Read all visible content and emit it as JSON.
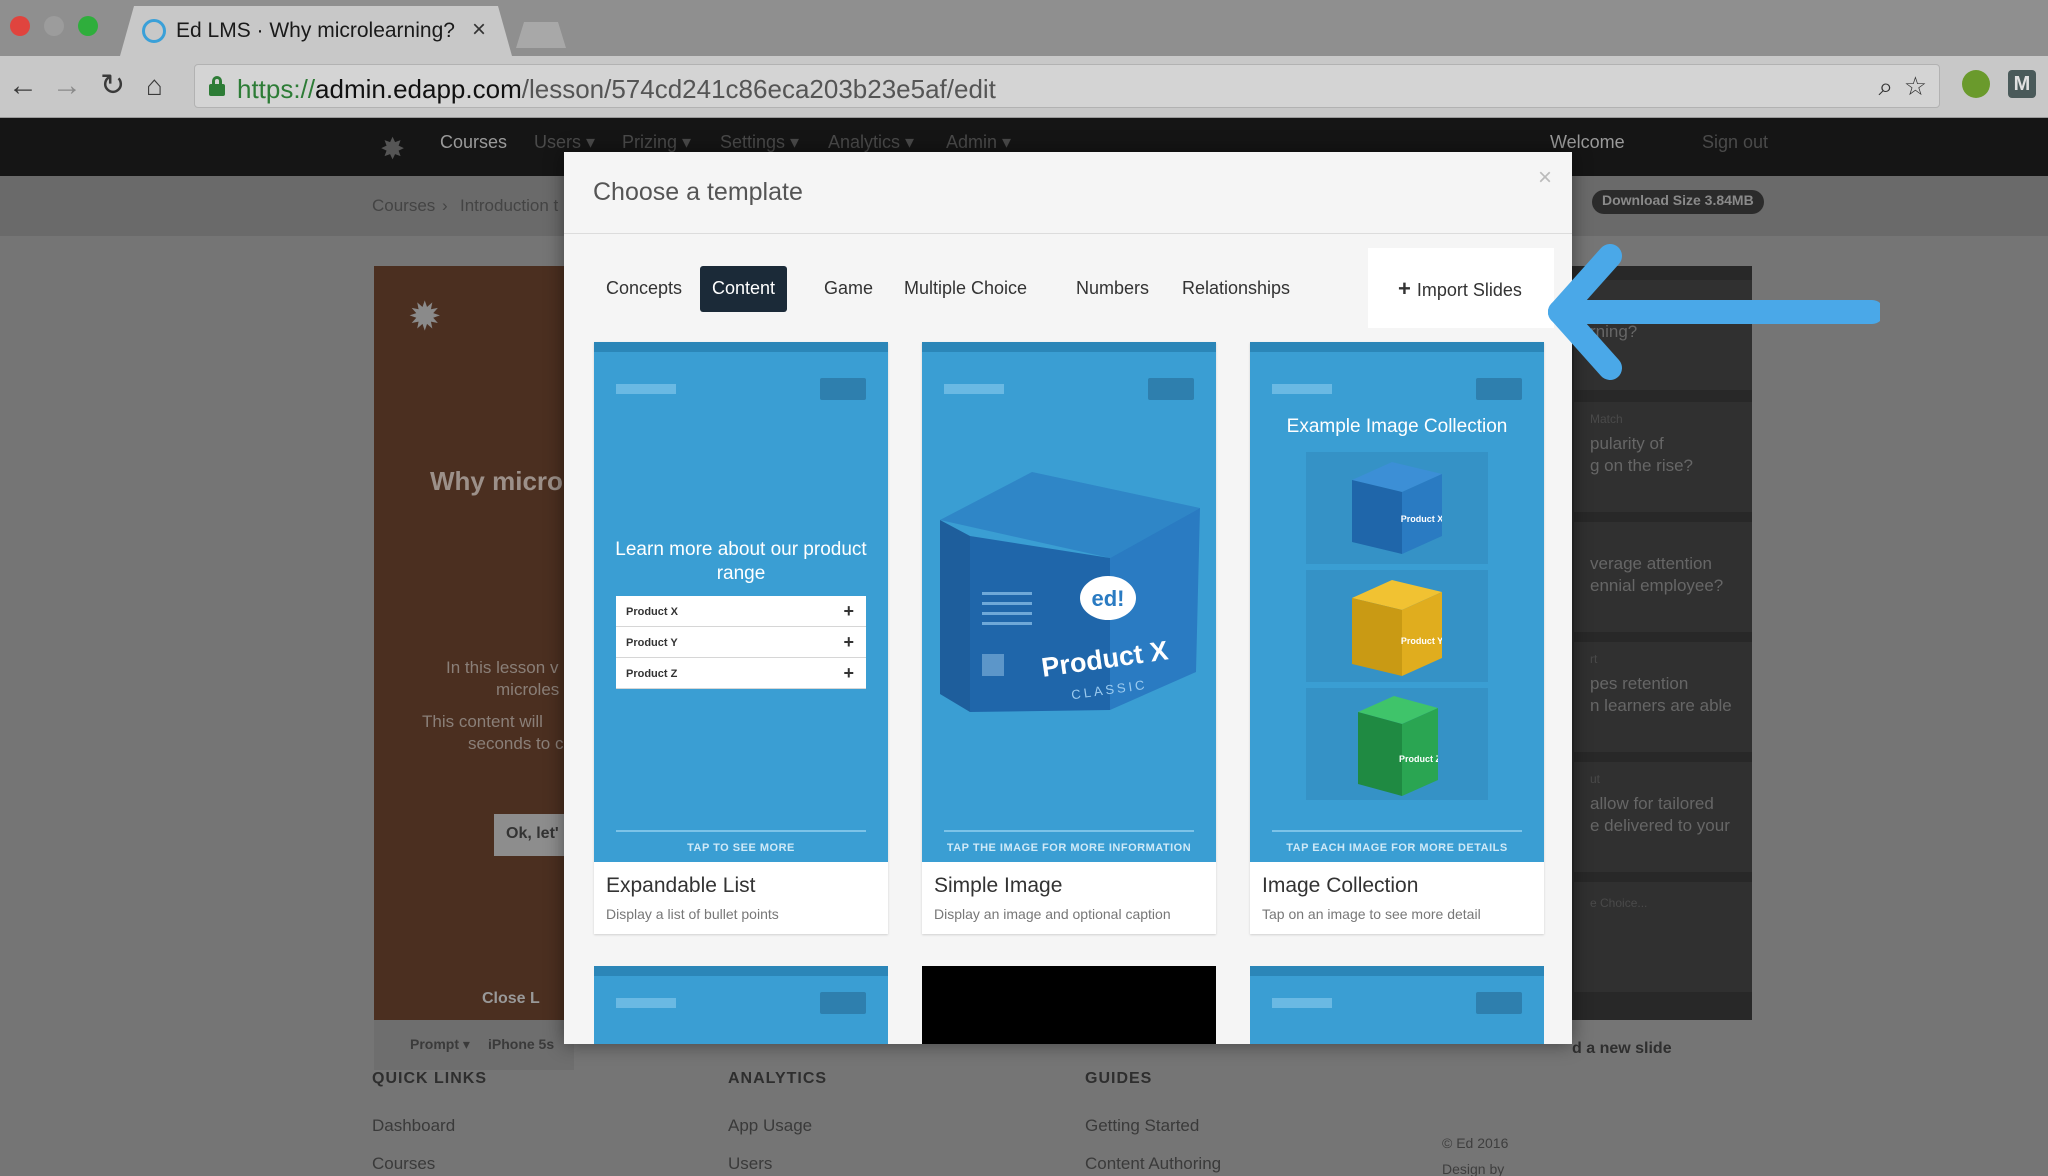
{
  "browser": {
    "tab_title": "Ed LMS · Why microlearning?",
    "url_scheme": "https://",
    "url_host": "admin.edapp.com",
    "url_path": "/lesson/574cd241c86eca203b23e5af/edit"
  },
  "app_nav": {
    "items": [
      "Courses",
      "Users ▾",
      "Prizing ▾",
      "Settings ▾",
      "Analytics ▾",
      "Admin ▾"
    ],
    "welcome": "Welcome",
    "sign_out": "Sign out"
  },
  "breadcrumb": {
    "root": "Courses",
    "sep": "›",
    "current": "Introduction t"
  },
  "download_badge": "Download Size 3.84MB",
  "preview": {
    "title": "Why micro",
    "line1": "In this lesson v",
    "line2": "microles",
    "line3": "This content will",
    "line4": "seconds to c",
    "button": "Ok, let'",
    "close": "Close L",
    "footer_prompt": "Prompt ▾",
    "footer_device": "iPhone 5s"
  },
  "slide_list": {
    "items": [
      {
        "tag": "",
        "text1": "rning?",
        "text2": ""
      },
      {
        "tag": "Match",
        "text1": "pularity of",
        "text2": "g on the rise?"
      },
      {
        "tag": "",
        "text1": "verage attention",
        "text2": "ennial employee?"
      },
      {
        "tag": "rt",
        "text1": "pes retention",
        "text2": "n learners are able"
      },
      {
        "tag": "ut",
        "text1": "allow for tailored",
        "text2": "e delivered to your"
      },
      {
        "tag": "e Choice...",
        "text1": "",
        "text2": ""
      }
    ],
    "add_new": "d a new slide"
  },
  "footer": {
    "quick_links": {
      "heading": "QUICK LINKS",
      "links": [
        "Dashboard",
        "Courses"
      ]
    },
    "analytics": {
      "heading": "ANALYTICS",
      "links": [
        "App Usage",
        "Users"
      ]
    },
    "guides": {
      "heading": "GUIDES",
      "links": [
        "Getting Started",
        "Content Authoring"
      ]
    },
    "copyright": "© Ed 2016",
    "design_by": "Design by"
  },
  "modal": {
    "title": "Choose a template",
    "close": "×",
    "tabs": [
      "Concepts",
      "Content",
      "Game",
      "Multiple Choice",
      "Numbers",
      "Relationships"
    ],
    "active_tab": "Content",
    "import_label": "Import Slides",
    "cards": [
      {
        "name": "Expandable List",
        "desc": "Display a list of bullet points",
        "heading": "Learn more about our product range",
        "items": [
          "Product X",
          "Product Y",
          "Product Z"
        ],
        "caption": "TAP TO SEE MORE"
      },
      {
        "name": "Simple Image",
        "desc": "Display an image and optional caption",
        "box_logo": "ed!",
        "box_product": "Product X",
        "box_sub": "CLASSIC",
        "caption": "TAP THE IMAGE FOR MORE INFORMATION"
      },
      {
        "name": "Image Collection",
        "desc": "Tap on an image to see more detail",
        "heading": "Example Image Collection",
        "tiles": [
          "Product X",
          "Product Y",
          "Product Z"
        ],
        "caption": "TAP EACH IMAGE FOR MORE DETAILS"
      }
    ]
  },
  "colors": {
    "accent_arrow": "#4aa8e8",
    "template_blue": "#3a9ed3",
    "active_tab": "#1b2a38"
  }
}
